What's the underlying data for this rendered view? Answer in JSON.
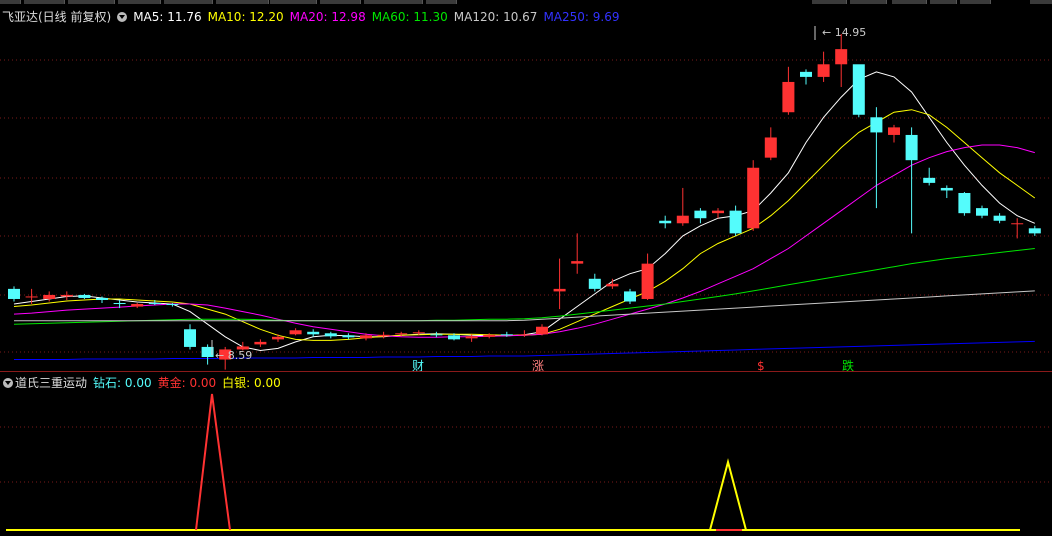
{
  "main_header": {
    "stock_title": "飞亚达(日线 前复权)",
    "ma5": "MA5: 11.76",
    "ma10": "MA10: 12.20",
    "ma20": "MA20: 12.98",
    "ma60": "MA60: 11.30",
    "ma120": "MA120: 10.67",
    "ma250": "MA250: 9.69"
  },
  "colors": {
    "up": "#ff3232",
    "down": "#54fcfc",
    "ma5": "#ffffff",
    "ma10": "#ffff00",
    "ma20": "#ff00ff",
    "ma60": "#00e600",
    "ma120": "#c8c8c8",
    "ma250": "#0000ff",
    "diamond": "#54fcfc",
    "gold": "#ff3232",
    "silver": "#ffff00"
  },
  "price_labels": {
    "high": "14.95",
    "low": "8.59"
  },
  "event_markers": [
    {
      "text": "财",
      "color": "#54fcfc"
    },
    {
      "text": "涨",
      "color": "#ff8080"
    },
    {
      "text": "$",
      "color": "#ff3232"
    },
    {
      "text": "跌",
      "color": "#00e600"
    }
  ],
  "indicator_header": {
    "name": "道氏三重运动",
    "diamond": "钻石: 0.00",
    "gold": "黄金: 0.00",
    "silver": "白银: 0.00"
  },
  "chart_data": {
    "type": "candlestick",
    "price_high": 14.95,
    "price_low": 8.59,
    "candles": [
      [
        9.9,
        9.7,
        9.95,
        9.65
      ],
      [
        9.75,
        9.75,
        9.9,
        9.6
      ],
      [
        9.7,
        9.78,
        9.85,
        9.65
      ],
      [
        9.75,
        9.78,
        9.85,
        9.68
      ],
      [
        9.78,
        9.72,
        9.8,
        9.7
      ],
      [
        9.72,
        9.68,
        9.75,
        9.62
      ],
      [
        9.62,
        9.6,
        9.68,
        9.52
      ],
      [
        9.55,
        9.6,
        9.62,
        9.52
      ],
      [
        9.62,
        9.6,
        9.68,
        9.58
      ],
      [
        9.6,
        9.58,
        9.62,
        9.55
      ],
      [
        9.1,
        8.75,
        9.2,
        8.7
      ],
      [
        8.75,
        8.55,
        8.8,
        8.4
      ],
      [
        8.5,
        8.7,
        8.75,
        8.3
      ],
      [
        8.7,
        8.76,
        8.85,
        8.68
      ],
      [
        8.8,
        8.85,
        8.9,
        8.75
      ],
      [
        8.9,
        8.95,
        9.0,
        8.85
      ],
      [
        9.0,
        9.08,
        9.12,
        8.98
      ],
      [
        9.05,
        9.0,
        9.1,
        8.95
      ],
      [
        9.02,
        8.96,
        9.05,
        8.92
      ],
      [
        8.98,
        8.94,
        9.02,
        8.9
      ],
      [
        8.92,
        8.98,
        9.02,
        8.88
      ],
      [
        8.96,
        8.99,
        9.05,
        8.92
      ],
      [
        9.0,
        9.02,
        9.05,
        8.96
      ],
      [
        9.02,
        9.04,
        9.08,
        8.98
      ],
      [
        9.0,
        8.98,
        9.05,
        8.94
      ],
      [
        8.98,
        8.9,
        9.02,
        8.88
      ],
      [
        8.92,
        8.96,
        9.0,
        8.85
      ],
      [
        8.95,
        8.99,
        9.02,
        8.92
      ],
      [
        9.0,
        8.98,
        9.05,
        8.95
      ],
      [
        8.98,
        9.0,
        9.08,
        8.95
      ],
      [
        9.0,
        9.15,
        9.2,
        8.98
      ],
      [
        9.85,
        9.9,
        10.5,
        9.5
      ],
      [
        10.4,
        10.45,
        11.0,
        10.2
      ],
      [
        10.1,
        9.9,
        10.2,
        9.85
      ],
      [
        9.95,
        10.0,
        10.1,
        9.9
      ],
      [
        9.85,
        9.65,
        9.9,
        9.6
      ],
      [
        9.7,
        10.4,
        10.6,
        9.68
      ],
      [
        11.25,
        11.2,
        11.35,
        11.1
      ],
      [
        11.2,
        11.35,
        11.9,
        11.15
      ],
      [
        11.45,
        11.3,
        11.5,
        11.2
      ],
      [
        11.4,
        11.45,
        11.5,
        11.3
      ],
      [
        11.45,
        11.0,
        11.55,
        10.95
      ],
      [
        11.1,
        12.3,
        12.45,
        11.05
      ],
      [
        12.5,
        12.9,
        13.1,
        12.45
      ],
      [
        13.4,
        14.0,
        14.3,
        13.35
      ],
      [
        14.2,
        14.1,
        14.25,
        13.95
      ],
      [
        14.1,
        14.35,
        14.6,
        14.0
      ],
      [
        14.35,
        14.65,
        14.95,
        13.9
      ],
      [
        14.35,
        13.35,
        13.45,
        13.3
      ],
      [
        13.3,
        13.0,
        13.5,
        11.5
      ],
      [
        12.95,
        13.1,
        13.15,
        12.8
      ],
      [
        12.95,
        12.45,
        13.1,
        11.0
      ],
      [
        12.1,
        12.0,
        12.3,
        11.95
      ],
      [
        11.9,
        11.85,
        11.95,
        11.7
      ],
      [
        11.8,
        11.4,
        11.82,
        11.35
      ],
      [
        11.5,
        11.35,
        11.55,
        11.3
      ],
      [
        11.35,
        11.25,
        11.4,
        11.2
      ],
      [
        11.2,
        11.2,
        11.3,
        10.9
      ],
      [
        11.1,
        11.0,
        11.15,
        10.95
      ]
    ],
    "ma_series": {
      "MA5": [
        9.6,
        9.65,
        9.7,
        9.75,
        9.76,
        9.72,
        9.68,
        9.64,
        9.62,
        9.6,
        9.45,
        9.2,
        8.95,
        8.75,
        8.68,
        8.72,
        8.85,
        8.95,
        8.98,
        8.97,
        8.95,
        8.95,
        8.98,
        9.0,
        9.01,
        9.0,
        8.98,
        8.97,
        8.97,
        8.99,
        9.05,
        9.3,
        9.55,
        9.8,
        10.05,
        10.2,
        10.3,
        10.6,
        10.95,
        11.15,
        11.3,
        11.35,
        11.45,
        11.8,
        12.2,
        12.8,
        13.3,
        13.7,
        14.05,
        14.2,
        14.1,
        13.8,
        13.3,
        12.8,
        12.35,
        11.95,
        11.6,
        11.35,
        11.2
      ],
      "MA10": [
        9.55,
        9.58,
        9.62,
        9.66,
        9.68,
        9.7,
        9.7,
        9.68,
        9.66,
        9.64,
        9.6,
        9.5,
        9.4,
        9.25,
        9.1,
        8.98,
        8.9,
        8.88,
        8.88,
        8.9,
        8.93,
        8.96,
        8.98,
        8.99,
        9.0,
        9.0,
        9.0,
        8.99,
        8.98,
        8.98,
        9.0,
        9.1,
        9.25,
        9.4,
        9.55,
        9.7,
        9.85,
        10.05,
        10.3,
        10.6,
        10.8,
        10.95,
        11.1,
        11.35,
        11.65,
        12.0,
        12.35,
        12.7,
        13.0,
        13.2,
        13.4,
        13.45,
        13.35,
        13.1,
        12.8,
        12.5,
        12.2,
        11.95,
        11.7
      ],
      "MA20": [
        9.4,
        9.42,
        9.45,
        9.48,
        9.5,
        9.52,
        9.54,
        9.56,
        9.58,
        9.6,
        9.6,
        9.58,
        9.52,
        9.45,
        9.38,
        9.3,
        9.22,
        9.15,
        9.1,
        9.05,
        9.0,
        8.97,
        8.95,
        8.94,
        8.94,
        8.95,
        8.95,
        8.96,
        8.97,
        8.98,
        9.0,
        9.05,
        9.12,
        9.2,
        9.3,
        9.4,
        9.5,
        9.6,
        9.72,
        9.85,
        10.0,
        10.15,
        10.3,
        10.5,
        10.7,
        10.95,
        11.2,
        11.45,
        11.7,
        11.95,
        12.15,
        12.35,
        12.5,
        12.62,
        12.7,
        12.75,
        12.75,
        12.7,
        12.6
      ],
      "MA60": [
        9.2,
        9.21,
        9.22,
        9.23,
        9.24,
        9.25,
        9.26,
        9.27,
        9.28,
        9.29,
        9.3,
        9.3,
        9.3,
        9.3,
        9.29,
        9.28,
        9.27,
        9.27,
        9.27,
        9.27,
        9.27,
        9.27,
        9.27,
        9.27,
        9.28,
        9.28,
        9.29,
        9.3,
        9.3,
        9.31,
        9.33,
        9.36,
        9.4,
        9.44,
        9.48,
        9.52,
        9.56,
        9.6,
        9.65,
        9.7,
        9.75,
        9.8,
        9.86,
        9.92,
        9.98,
        10.04,
        10.1,
        10.16,
        10.22,
        10.28,
        10.34,
        10.4,
        10.45,
        10.5,
        10.54,
        10.58,
        10.62,
        10.66,
        10.7
      ],
      "MA120": [
        9.27,
        9.27,
        9.27,
        9.27,
        9.27,
        9.27,
        9.27,
        9.27,
        9.27,
        9.27,
        9.27,
        9.27,
        9.27,
        9.27,
        9.27,
        9.27,
        9.27,
        9.27,
        9.27,
        9.27,
        9.27,
        9.27,
        9.27,
        9.27,
        9.27,
        9.27,
        9.27,
        9.27,
        9.27,
        9.28,
        9.3,
        9.32,
        9.34,
        9.36,
        9.38,
        9.4,
        9.42,
        9.44,
        9.46,
        9.48,
        9.5,
        9.52,
        9.54,
        9.56,
        9.58,
        9.6,
        9.62,
        9.64,
        9.66,
        9.68,
        9.7,
        9.72,
        9.74,
        9.76,
        9.78,
        9.8,
        9.82,
        9.84,
        9.86
      ],
      "MA250": [
        8.5,
        8.5,
        8.5,
        8.5,
        8.51,
        8.51,
        8.51,
        8.51,
        8.51,
        8.52,
        8.52,
        8.52,
        8.52,
        8.53,
        8.53,
        8.53,
        8.53,
        8.54,
        8.54,
        8.54,
        8.54,
        8.55,
        8.55,
        8.55,
        8.56,
        8.56,
        8.56,
        8.57,
        8.57,
        8.57,
        8.58,
        8.59,
        8.6,
        8.61,
        8.62,
        8.63,
        8.64,
        8.65,
        8.66,
        8.67,
        8.68,
        8.69,
        8.7,
        8.71,
        8.72,
        8.73,
        8.74,
        8.75,
        8.76,
        8.77,
        8.78,
        8.79,
        8.8,
        8.81,
        8.82,
        8.83,
        8.84,
        8.85,
        8.86
      ]
    },
    "indicator": {
      "gold_spike": {
        "peak": 1.0
      },
      "silver_spike": {
        "peak": 0.5
      }
    }
  }
}
